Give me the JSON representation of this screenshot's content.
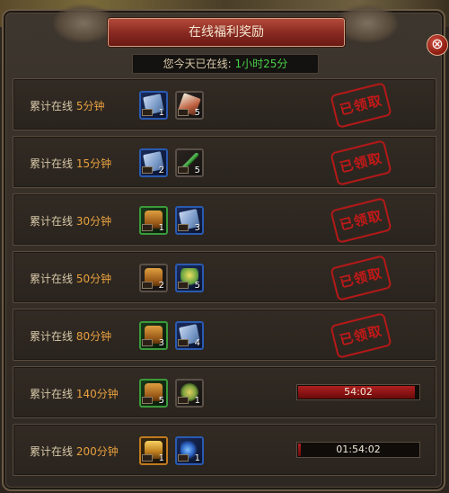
{
  "window": {
    "title": "在线福利奖励"
  },
  "online": {
    "label": "您今天已在线:",
    "value": "1小时25分"
  },
  "rows": [
    {
      "prefix": "累计在线",
      "minutes": "5分钟",
      "stamp": "已领取",
      "items": [
        {
          "icon": "scroll-icon",
          "count": "1"
        },
        {
          "icon": "fan-icon",
          "count": "5"
        }
      ]
    },
    {
      "prefix": "累计在线",
      "minutes": "15分钟",
      "stamp": "已领取",
      "items": [
        {
          "icon": "scroll-icon",
          "count": "2"
        },
        {
          "icon": "sword-icon",
          "count": "5"
        }
      ]
    },
    {
      "prefix": "累计在线",
      "minutes": "30分钟",
      "stamp": "已领取",
      "items": [
        {
          "icon": "chest-icon",
          "count": "1"
        },
        {
          "icon": "scroll-icon",
          "count": "3"
        }
      ]
    },
    {
      "prefix": "累计在线",
      "minutes": "50分钟",
      "stamp": "已领取",
      "items": [
        {
          "icon": "chest-icon",
          "count": "2"
        },
        {
          "icon": "flower-icon",
          "count": "5"
        }
      ]
    },
    {
      "prefix": "累计在线",
      "minutes": "80分钟",
      "stamp": "已领取",
      "items": [
        {
          "icon": "chest-icon",
          "count": "3"
        },
        {
          "icon": "scroll-icon",
          "count": "4"
        }
      ]
    },
    {
      "prefix": "累计在线",
      "minutes": "140分钟",
      "timer": "54:02",
      "progress": 0.97,
      "items": [
        {
          "icon": "chest-icon",
          "count": "5"
        },
        {
          "icon": "medal-icon",
          "count": "1"
        }
      ]
    },
    {
      "prefix": "累计在线",
      "minutes": "200分钟",
      "timer": "01:54:02",
      "progress": 0.02,
      "items": [
        {
          "icon": "gold-chest-icon",
          "count": "1"
        },
        {
          "icon": "moon-icon",
          "count": "1"
        }
      ]
    }
  ],
  "close": {
    "symbol": "⊗"
  }
}
